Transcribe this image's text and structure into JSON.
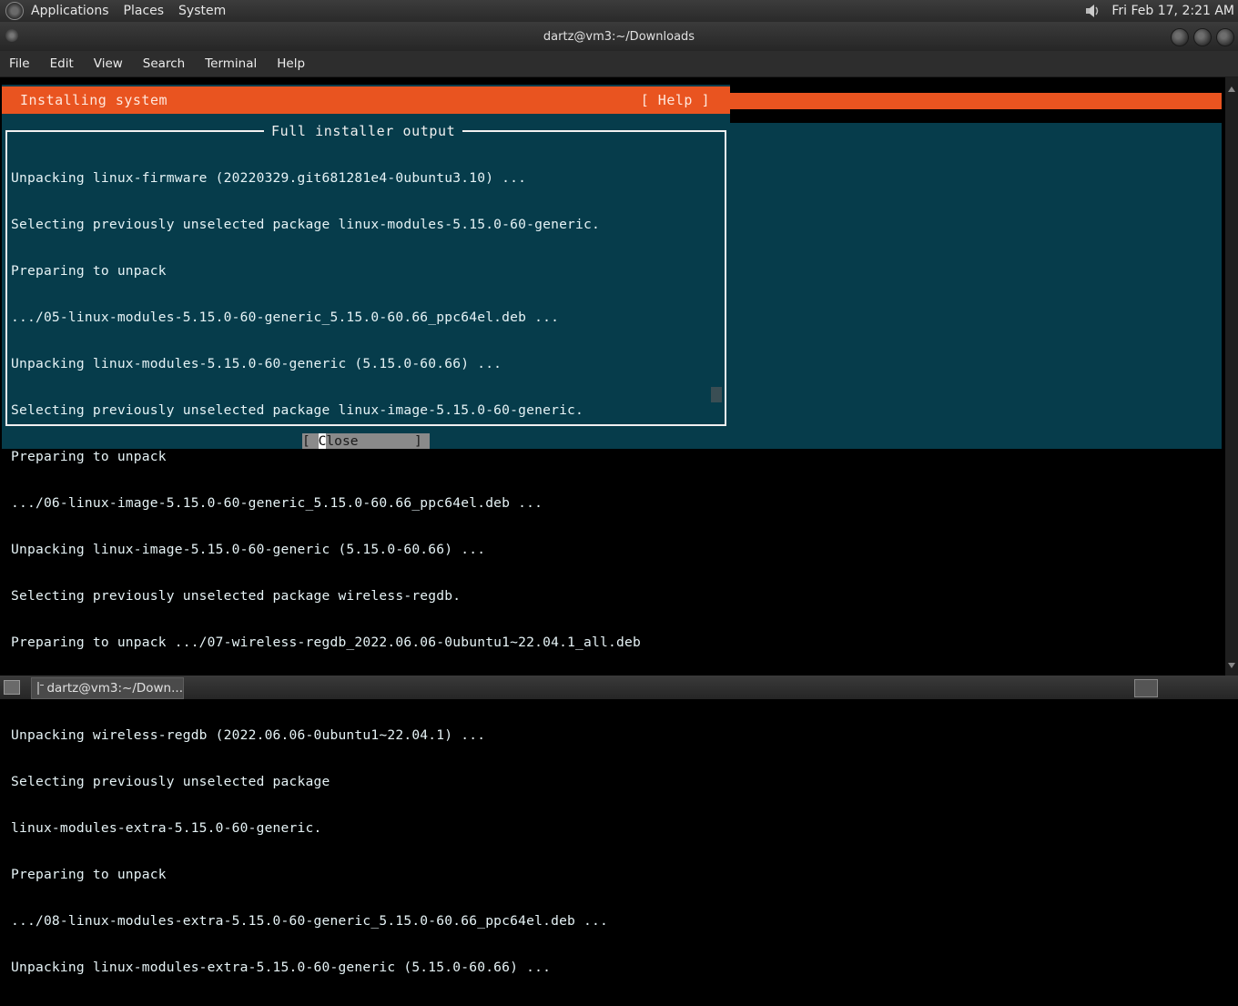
{
  "top_panel": {
    "menus": [
      "Applications",
      "Places",
      "System"
    ],
    "clock": "Fri Feb 17,  2:21 AM"
  },
  "window": {
    "title": "dartz@vm3:~/Downloads"
  },
  "menubar": {
    "items": [
      "File",
      "Edit",
      "View",
      "Search",
      "Terminal",
      "Help"
    ]
  },
  "installer": {
    "header_title": "Installing system",
    "help_label": "[ Help ]",
    "output_title": "Full installer output",
    "log_lines": [
      "Unpacking linux-firmware (20220329.git681281e4-0ubuntu3.10) ...",
      "Selecting previously unselected package linux-modules-5.15.0-60-generic.",
      "Preparing to unpack",
      ".../05-linux-modules-5.15.0-60-generic_5.15.0-60.66_ppc64el.deb ...",
      "Unpacking linux-modules-5.15.0-60-generic (5.15.0-60.66) ...",
      "Selecting previously unselected package linux-image-5.15.0-60-generic.",
      "Preparing to unpack",
      ".../06-linux-image-5.15.0-60-generic_5.15.0-60.66_ppc64el.deb ...",
      "Unpacking linux-image-5.15.0-60-generic (5.15.0-60.66) ...",
      "Selecting previously unselected package wireless-regdb.",
      "Preparing to unpack .../07-wireless-regdb_2022.06.06-0ubuntu1~22.04.1_all.deb",
      "...",
      "Unpacking wireless-regdb (2022.06.06-0ubuntu1~22.04.1) ...",
      "Selecting previously unselected package",
      "linux-modules-extra-5.15.0-60-generic.",
      "Preparing to unpack",
      ".../08-linux-modules-extra-5.15.0-60-generic_5.15.0-60.66_ppc64el.deb ...",
      "Unpacking linux-modules-extra-5.15.0-60-generic (5.15.0-60.66) ..."
    ],
    "close_button": {
      "left": "[ ",
      "highlight": "C",
      "rest": "lose       ]"
    }
  },
  "bottom_panel": {
    "task_label": "dartz@vm3:~/Down..."
  },
  "icons": {
    "panel_logo": "gnome-foot-icon",
    "volume": "speaker-icon",
    "task": "terminal-icon"
  },
  "colors": {
    "accent_orange": "#e95420",
    "dialog_teal": "#063c4b"
  }
}
